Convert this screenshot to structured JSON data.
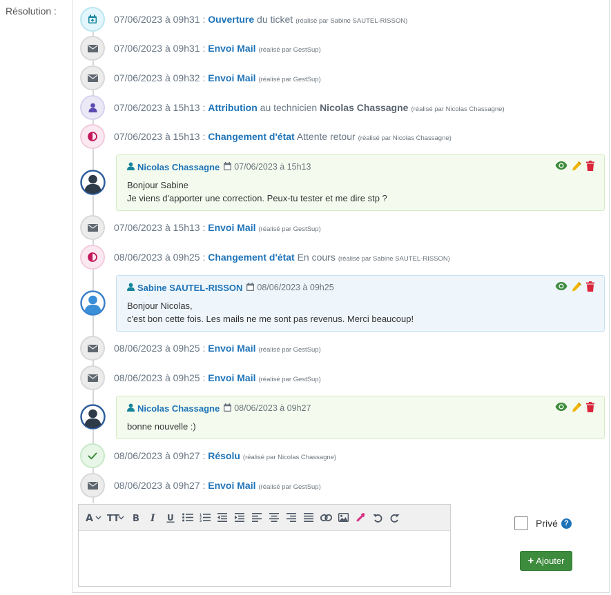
{
  "resolution_label": "Résolution :",
  "colors": {
    "link": "#1e73b8",
    "view": "#3d8b3d",
    "edit": "#f0b400",
    "delete": "#d9263b",
    "button": "#3d8b3d"
  },
  "timeline": [
    {
      "icon": "calendar-plus-icon",
      "date": "07/06/2023 à 09h31 :",
      "action": "Ouverture",
      "detail": "du ticket",
      "by": "(réalisé par Sabine SAUTEL-RISSON)"
    },
    {
      "icon": "envelope-icon",
      "date": "07/06/2023 à 09h31 :",
      "action": "Envoi Mail",
      "by": "(réalisé par GestSup)"
    },
    {
      "icon": "envelope-icon",
      "date": "07/06/2023 à 09h32 :",
      "action": "Envoi Mail",
      "by": "(réalisé par GestSup)"
    },
    {
      "icon": "user-icon",
      "date": "07/06/2023 à 15h13 :",
      "action": "Attribution",
      "detail": "au technicien",
      "technician": "Nicolas Chassagne",
      "by": "(réalisé par Nicolas Chassagne)"
    },
    {
      "icon": "half-circle-icon",
      "date": "07/06/2023 à 15h13 :",
      "action": "Changement d'état",
      "detail": "Attente retour",
      "by": "(réalisé par Nicolas Chassagne)"
    },
    {
      "icon": "envelope-icon",
      "date": "07/06/2023 à 15h13 :",
      "action": "Envoi Mail",
      "by": "(réalisé par GestSup)"
    },
    {
      "icon": "half-circle-icon",
      "date": "08/06/2023 à 09h25 :",
      "action": "Changement d'état",
      "detail": "En cours",
      "by": "(réalisé par Sabine SAUTEL-RISSON)"
    },
    {
      "icon": "envelope-icon",
      "date": "08/06/2023 à 09h25 :",
      "action": "Envoi Mail",
      "by": "(réalisé par GestSup)"
    },
    {
      "icon": "envelope-icon",
      "date": "08/06/2023 à 09h25 :",
      "action": "Envoi Mail",
      "by": "(réalisé par GestSup)"
    },
    {
      "icon": "check-icon",
      "date": "08/06/2023 à 09h27 :",
      "action": "Résolu",
      "by": "(réalisé par Nicolas Chassagne)"
    },
    {
      "icon": "envelope-icon",
      "date": "08/06/2023 à 09h27 :",
      "action": "Envoi Mail",
      "by": "(réalisé par GestSup)"
    }
  ],
  "messages": [
    {
      "author": "Nicolas Chassagne",
      "date": "07/06/2023 à 15h13",
      "lines": [
        "Bonjour Sabine",
        "Je viens d'apporter une correction. Peux-tu tester et me dire stp ?"
      ]
    },
    {
      "author": "Sabine SAUTEL-RISSON",
      "date": "08/06/2023 à 09h25",
      "lines": [
        "Bonjour Nicolas,",
        "c'est bon cette fois. Les mails ne me sont pas revenus. Merci beaucoup!"
      ]
    },
    {
      "author": "Nicolas Chassagne",
      "date": "08/06/2023 à 09h27",
      "lines": [
        "bonne nouvelle :)"
      ]
    }
  ],
  "editor": {
    "toolbar": [
      "font-icon",
      "text-height-icon",
      "bold-icon",
      "italic-icon",
      "underline-icon",
      "bullet-list-icon",
      "numbered-list-icon",
      "outdent-icon",
      "indent-icon",
      "align-left-icon",
      "align-center-icon",
      "align-right-icon",
      "justify-icon",
      "link-icon",
      "image-icon",
      "color-picker-icon",
      "undo-icon",
      "redo-icon"
    ]
  },
  "private_label": "Privé",
  "help_icon": "?",
  "add_button": {
    "plus": "+",
    "label": "Ajouter"
  }
}
